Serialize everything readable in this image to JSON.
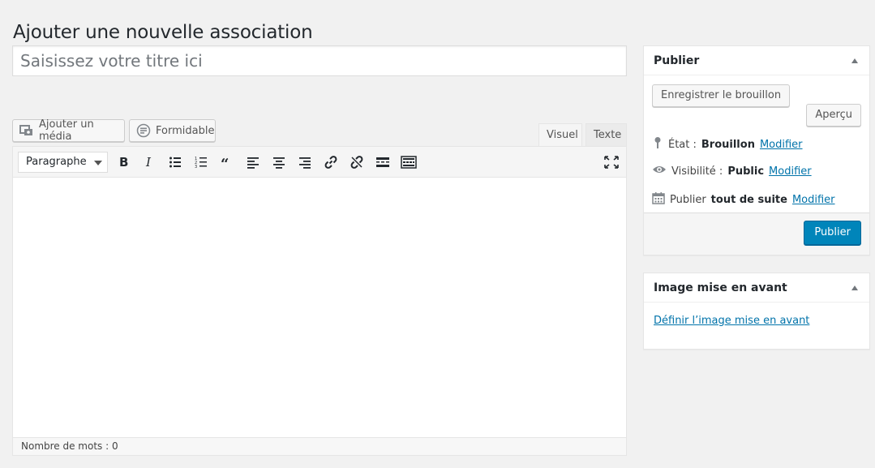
{
  "page": {
    "title": "Ajouter une nouvelle association"
  },
  "title_field": {
    "placeholder": "Saisissez votre titre ici",
    "value": ""
  },
  "media_buttons": {
    "add_media": "Ajouter un média",
    "formidable": "Formidable"
  },
  "editor": {
    "tabs": {
      "visual": "Visuel",
      "text": "Texte"
    },
    "format_select": "Paragraphe",
    "toolbar_icons": [
      "bold-icon",
      "italic-icon",
      "bullet-list-icon",
      "numbered-list-icon",
      "blockquote-icon",
      "align-left-icon",
      "align-center-icon",
      "align-right-icon",
      "link-icon",
      "unlink-icon",
      "read-more-icon",
      "toolbar-toggle-icon",
      "fullscreen-icon"
    ],
    "word_count": "Nombre de mots : 0"
  },
  "publish_box": {
    "title": "Publier",
    "save_draft": "Enregistrer le brouillon",
    "preview": "Aperçu",
    "status_label": "État :",
    "status_value": "Brouillon",
    "visibility_label": "Visibilité :",
    "visibility_value": "Public",
    "schedule_label": "Publier",
    "schedule_value": "tout de suite",
    "edit_link": "Modifier",
    "publish_button": "Publier"
  },
  "featured_image_box": {
    "title": "Image mise en avant",
    "set_link": "Définir l’image mise en avant"
  },
  "colors": {
    "primary": "#0085ba",
    "link": "#0073aa",
    "background": "#f1f1f1"
  }
}
